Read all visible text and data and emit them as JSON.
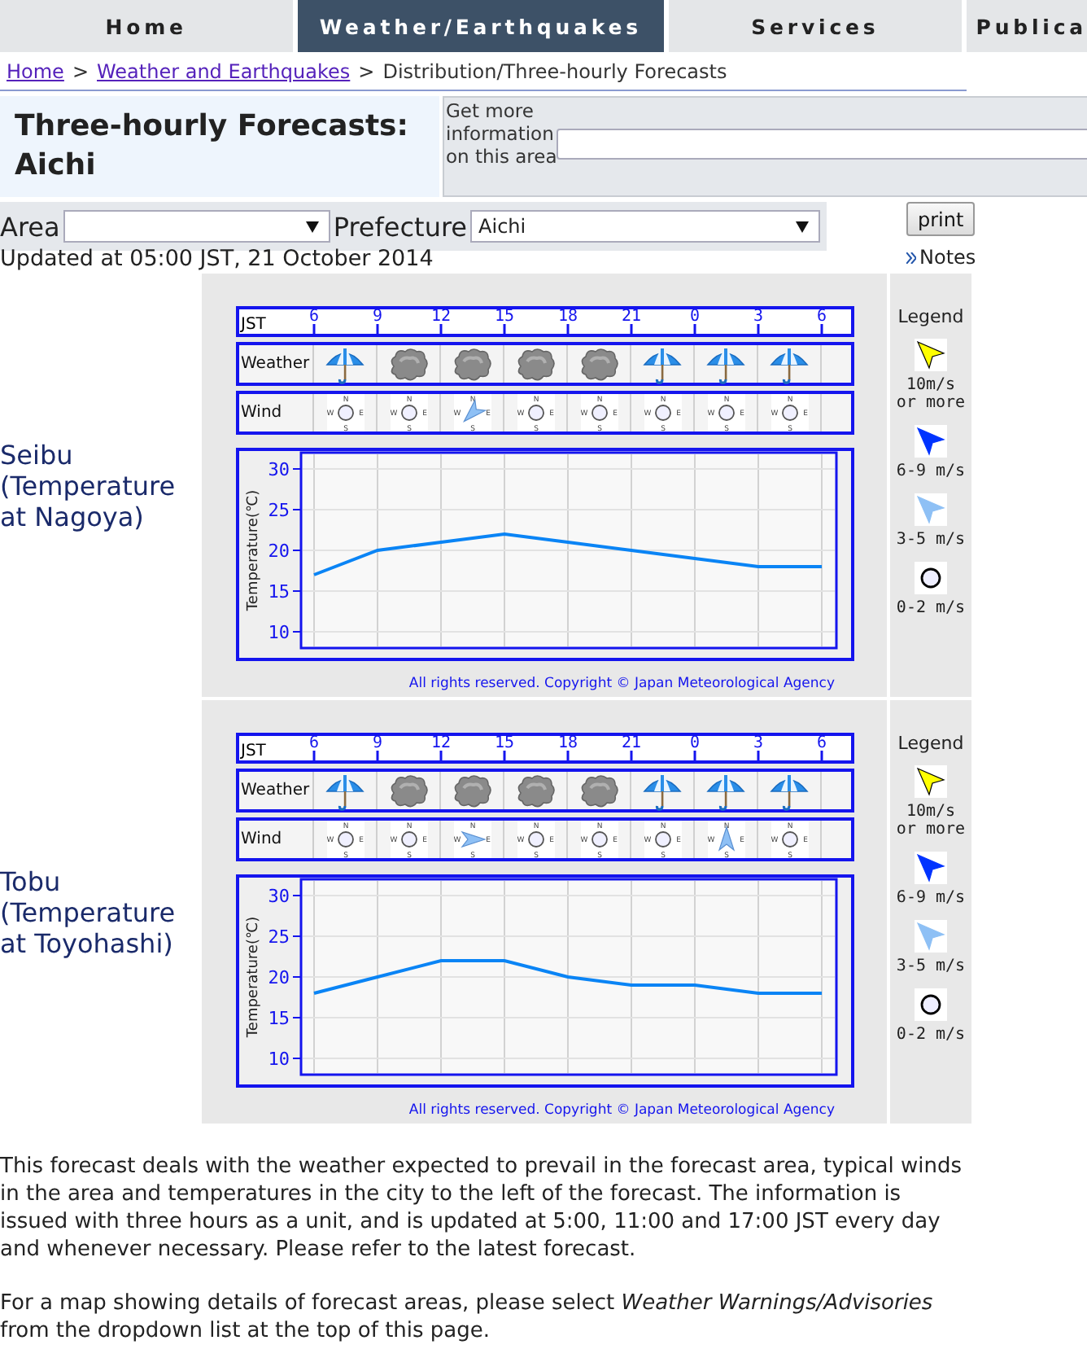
{
  "nav": {
    "tabs": [
      {
        "label": "Home",
        "selected": false
      },
      {
        "label": "Weather/Earthquakes",
        "selected": true
      },
      {
        "label": "Services",
        "selected": false
      },
      {
        "label": "Publica",
        "selected": false
      }
    ]
  },
  "breadcrumb": [
    {
      "label": "Home",
      "kind": "link"
    },
    {
      "sep": ">",
      "label": "Weather and Earthquakes",
      "kind": "link"
    },
    {
      "sep": ">",
      "label": "Distribution/Three-hourly Forecasts",
      "kind": "current"
    }
  ],
  "header": {
    "title": "Three-hourly Forecasts: Aichi",
    "info_label": "Get more information on this area"
  },
  "filters": {
    "area_label": "Area",
    "prefecture_label": "Prefecture",
    "prefecture_value": "Aichi"
  },
  "print_button": "print",
  "notes_link": "Notes",
  "updated": "Updated at 05:00 JST, 21 October 2014",
  "forecasts": [
    {
      "label": "Seibu (Temperature at Nagoya)",
      "time_label": "JST",
      "weather_label": "Weather",
      "wind_label": "Wind",
      "weather": [
        {
          "kind": "rain"
        },
        {
          "kind": "cloudy"
        },
        {
          "kind": "cloudy"
        },
        {
          "kind": "cloudy"
        },
        {
          "kind": "cloudy"
        },
        {
          "kind": "rain"
        },
        {
          "kind": "rain"
        },
        {
          "kind": "rain"
        }
      ],
      "wind": [
        {
          "kind": "calm",
          "compass": [
            "N",
            "W",
            "E",
            "S"
          ]
        },
        {
          "kind": "calm",
          "compass": [
            "N",
            "W",
            "E",
            "S"
          ]
        },
        {
          "kind": "southwest",
          "compass": [
            "N",
            "W",
            "E",
            "S"
          ]
        },
        {
          "kind": "calm",
          "compass": [
            "N",
            "W",
            "E",
            "S"
          ]
        },
        {
          "kind": "calm",
          "compass": [
            "N",
            "W",
            "E",
            "S"
          ]
        },
        {
          "kind": "calm",
          "compass": [
            "N",
            "W",
            "E",
            "S"
          ]
        },
        {
          "kind": "calm",
          "compass": [
            "N",
            "W",
            "E",
            "S"
          ]
        },
        {
          "kind": "calm",
          "compass": [
            "N",
            "W",
            "E",
            "S"
          ]
        }
      ],
      "time_ticks": [
        "6",
        "9",
        "12",
        "15",
        "18",
        "21",
        "0",
        "3",
        "6"
      ],
      "chart_data": {
        "type": "line",
        "ylabel": "Temperature(℃)",
        "grid": true,
        "ylim": [
          8,
          32
        ],
        "yticks": [
          10,
          15,
          20,
          25,
          30
        ],
        "series": [
          {
            "color": "#0a84f5",
            "values": [
              17,
              20,
              21,
              22,
              21,
              20,
              19,
              18,
              18
            ]
          }
        ]
      },
      "copyright": "All rights reserved. Copyright © Japan Meteorological Agency",
      "legend": {
        "title": "Legend",
        "items": [
          {
            "kind": "arrow",
            "color": "#ffff00",
            "text": "10m/s or more"
          },
          {
            "kind": "arrow",
            "color": "#0033ff",
            "text": "6-9 m/s"
          },
          {
            "kind": "arrow",
            "color": "#8ec0f5",
            "text": "3-5 m/s"
          },
          {
            "kind": "calm",
            "color": "#eeeeff",
            "text": "0-2 m/s"
          }
        ]
      }
    },
    {
      "label": "Tobu (Temperature at Toyohashi)",
      "time_label": "JST",
      "weather_label": "Weather",
      "wind_label": "Wind",
      "weather": [
        {
          "kind": "rain"
        },
        {
          "kind": "cloudy"
        },
        {
          "kind": "cloudy"
        },
        {
          "kind": "cloudy"
        },
        {
          "kind": "cloudy"
        },
        {
          "kind": "rain"
        },
        {
          "kind": "rain"
        },
        {
          "kind": "rain"
        }
      ],
      "wind": [
        {
          "kind": "calm",
          "compass": [
            "N",
            "W",
            "E",
            "S"
          ]
        },
        {
          "kind": "calm",
          "compass": [
            "N",
            "W",
            "E",
            "S"
          ]
        },
        {
          "kind": "east",
          "compass": [
            "N",
            "W",
            "E",
            "S"
          ]
        },
        {
          "kind": "calm",
          "compass": [
            "N",
            "W",
            "E",
            "S"
          ]
        },
        {
          "kind": "calm",
          "compass": [
            "N",
            "W",
            "E",
            "S"
          ]
        },
        {
          "kind": "calm",
          "compass": [
            "N",
            "W",
            "E",
            "S"
          ]
        },
        {
          "kind": "north",
          "compass": [
            "N",
            "W",
            "E",
            "S"
          ]
        },
        {
          "kind": "calm",
          "compass": [
            "N",
            "W",
            "E",
            "S"
          ]
        }
      ],
      "time_ticks": [
        "6",
        "9",
        "12",
        "15",
        "18",
        "21",
        "0",
        "3",
        "6"
      ],
      "chart_data": {
        "type": "line",
        "ylabel": "Temperature(℃)",
        "grid": true,
        "ylim": [
          8,
          32
        ],
        "yticks": [
          10,
          15,
          20,
          25,
          30
        ],
        "series": [
          {
            "color": "#0a84f5",
            "values": [
              18,
              20,
              22,
              22,
              20,
              19,
              19,
              18,
              18
            ]
          }
        ]
      },
      "copyright": "All rights reserved. Copyright © Japan Meteorological Agency",
      "legend": {
        "title": "Legend",
        "items": [
          {
            "kind": "arrow",
            "color": "#ffff00",
            "text": "10m/s or more"
          },
          {
            "kind": "arrow",
            "color": "#0033ff",
            "text": "6-9 m/s"
          },
          {
            "kind": "arrow",
            "color": "#8ec0f5",
            "text": "3-5 m/s"
          },
          {
            "kind": "calm",
            "color": "#eeeeff",
            "text": "0-2 m/s"
          }
        ]
      }
    }
  ],
  "paragraphs": [
    "This forecast deals with the weather expected to prevail in the forecast area, typical winds in the area and temperatures in the city to the left of the forecast. The information is issued with three hours as a unit, and is updated at 5:00, 11:00 and 17:00 JST every day and whenever necessary. Please refer to the latest forecast.",
    "For a map showing details of forecast areas, please select *Weather Warnings/Advisories* from the dropdown list at the top of this page."
  ]
}
